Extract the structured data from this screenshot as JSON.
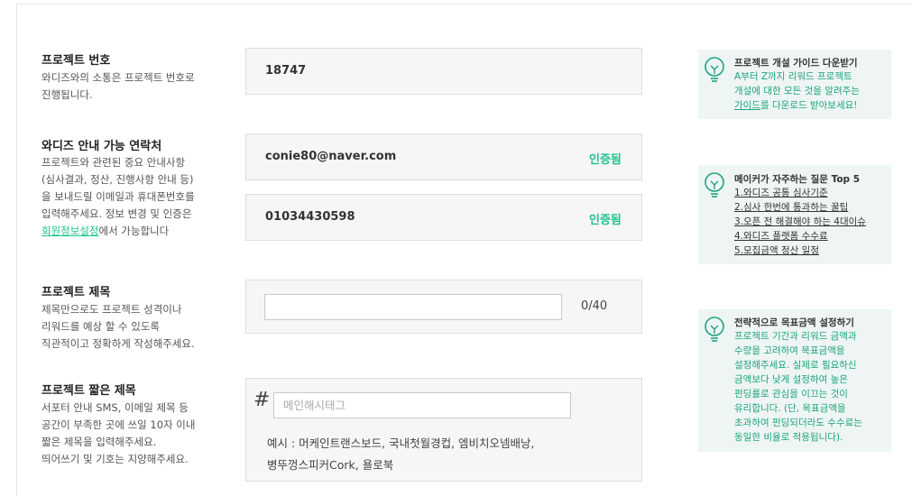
{
  "project_number": {
    "title": "프로젝트 번호",
    "desc_line1": "와디즈와의 소통은 프로젝트 번호로",
    "desc_line2": "진행됩니다.",
    "value": "18747"
  },
  "contact": {
    "title": "와디즈 안내 가능 연락처",
    "desc_line1": "프로젝트와 관련된 중요 안내사항",
    "desc_line2": "(심사결과, 정산, 진행사항 안내 등)",
    "desc_line3": "을 보내드릴 이메일과 휴대폰번호를",
    "desc_line4": "입력해주세요. 정보 변경 및 인증은",
    "desc_link": "회원정보설정",
    "desc_after_link": "에서 가능합니다",
    "email": "conie80@naver.com",
    "email_status": "인증됨",
    "phone": "01034430598",
    "phone_status": "인증됨"
  },
  "project_title": {
    "title": "프로젝트 제목",
    "desc_line1": "제목만으로도 프로젝트 성격이나",
    "desc_line2": "리워드를 예상 할 수 있도록",
    "desc_line3": "직관적이고 정확하게 작성해주세요.",
    "value": "",
    "counter": "0/40"
  },
  "short_title": {
    "title": "프로젝트 짧은 제목",
    "desc_line1": "서포터 안내 SMS, 이메일 제목 등",
    "desc_line2": "공간이 부족한 곳에 쓰일 10자 이내",
    "desc_line3": "짧은 제목을 입력해주세요.",
    "desc_line4": "띄어쓰기 및 기호는 지양해주세요.",
    "hash": "#",
    "placeholder": "메인해시태그",
    "example_line1": "예시 : 머케인트랜스보드, 국내첫월경컵, 엠비치오넴배낭,",
    "example_line2": "병뚜껑스피커Cork, 욜로북"
  },
  "tips": {
    "guide": {
      "title": "프로젝트 개설 가이드 다운받기",
      "line1": "A부터 Z까지 리워드 프로젝트",
      "line2": "개설에 대한 모든 것을 알려주는",
      "link": "가이드",
      "after_link": "를 다운로드 받아보세요!"
    },
    "faq": {
      "title": "메이커가 자주하는 질문 Top 5",
      "items": [
        "1.와디즈 공통 심사기준",
        "2.심사 한번에 통과하는 꿀팁",
        "3.오픈 전 해결해야 하는 4대이슈",
        "4.와디즈 플랫폼 수수료",
        "5.모집금액 정산 일정"
      ]
    },
    "goal": {
      "title": "전략적으로 목표금액 설정하기",
      "line1": "프로젝트 기간과 리워드 금액과",
      "line2": "수량을 고려하여 목표금액을",
      "line3": "설정해주세요. 실제로 필요하신",
      "line4": "금액보다 낮게 설정하여 높은",
      "line5": "펀딩률로 관심을 이끄는 것이",
      "line6": "유리합니다. (단, 목표금액을",
      "line7": "초과하여 펀딩되더라도 수수료는",
      "line8": "동일한 비율로 적용됩니다)."
    }
  },
  "colors": {
    "accent": "#1fc38e",
    "tip_bg": "#eef5f4",
    "box_bg": "#f6f6f6"
  }
}
